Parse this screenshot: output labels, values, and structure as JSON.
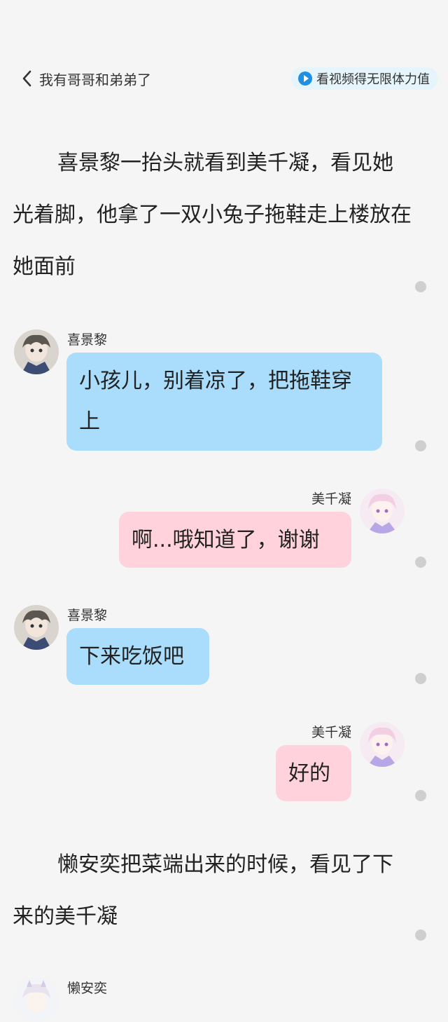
{
  "header": {
    "back_title": "我有哥哥和弟弟了",
    "video_label": "看视频得无限体力值"
  },
  "narration": [
    "喜景黎一抬头就看到美千凝，看见她光着脚，他拿了一双小兔子拖鞋走上楼放在她面前",
    "懒安奕把菜端出来的时候，看见了下来的美千凝"
  ],
  "messages": [
    {
      "speaker": "喜景黎",
      "text": "小孩儿，别着凉了，把拖鞋穿上"
    },
    {
      "speaker": "美千凝",
      "text": "啊...哦知道了，谢谢"
    },
    {
      "speaker": "喜景黎",
      "text": "下来吃饭吧"
    },
    {
      "speaker": "美千凝",
      "text": "好的"
    }
  ],
  "next_speaker": "懒安奕",
  "colors": {
    "left_bubble": "#a9ddfb",
    "right_bubble": "#ffd2dc",
    "background": "#f5f5f5",
    "video_icon": "#1e90e6"
  },
  "icons": {
    "back": "chevron-left-icon",
    "video": "play-circle-icon",
    "comment": "comment-dot-icon"
  }
}
